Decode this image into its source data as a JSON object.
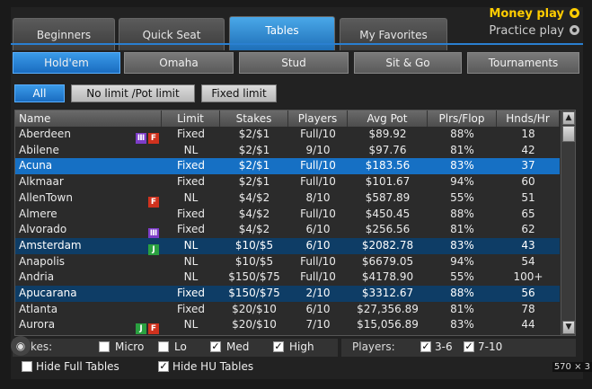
{
  "top_tabs": [
    "Beginners",
    "Quick Seat",
    "Tables",
    "My Favorites"
  ],
  "active_top_tab": "Tables",
  "mode": {
    "money": "Money play",
    "practice": "Practice play"
  },
  "game_tabs": [
    "Hold'em",
    "Omaha",
    "Stud",
    "Sit & Go",
    "Tournaments"
  ],
  "active_game_tab": "Hold'em",
  "limit_filters": [
    "All",
    "No limit /Pot limit",
    "Fixed limit"
  ],
  "active_limit_filter": "All",
  "columns": [
    "Name",
    "Limit",
    "Stakes",
    "Players",
    "Avg Pot",
    "Plrs/Flop",
    "Hnds/Hr"
  ],
  "rows": [
    {
      "name": "Aberdeen",
      "badges": [
        "stats-icon",
        "fast-icon"
      ],
      "limit": "Fixed",
      "stakes": "$2/$1",
      "players": "Full/10",
      "avg_pot": "$89.92",
      "plrs_flop": "88%",
      "hnds_hr": "18",
      "state": ""
    },
    {
      "name": "Abilene",
      "badges": [],
      "limit": "NL",
      "stakes": "$2/$1",
      "players": "9/10",
      "avg_pot": "$97.76",
      "plrs_flop": "81%",
      "hnds_hr": "42",
      "state": ""
    },
    {
      "name": "Acuna",
      "badges": [],
      "limit": "Fixed",
      "stakes": "$2/$1",
      "players": "Full/10",
      "avg_pot": "$183.56",
      "plrs_flop": "83%",
      "hnds_hr": "37",
      "state": "sel"
    },
    {
      "name": "Alkmaar",
      "badges": [],
      "limit": "Fixed",
      "stakes": "$2/$1",
      "players": "Full/10",
      "avg_pot": "$101.67",
      "plrs_flop": "94%",
      "hnds_hr": "60",
      "state": ""
    },
    {
      "name": "AllenTown",
      "badges": [
        "fast-icon"
      ],
      "limit": "NL",
      "stakes": "$4/$2",
      "players": "8/10",
      "avg_pot": "$587.89",
      "plrs_flop": "55%",
      "hnds_hr": "51",
      "state": ""
    },
    {
      "name": "Almere",
      "badges": [],
      "limit": "Fixed",
      "stakes": "$4/$2",
      "players": "Full/10",
      "avg_pot": "$450.45",
      "plrs_flop": "88%",
      "hnds_hr": "65",
      "state": ""
    },
    {
      "name": "Alvorado",
      "badges": [
        "stats-icon"
      ],
      "limit": "Fixed",
      "stakes": "$4/$2",
      "players": "6/10",
      "avg_pot": "$256.56",
      "plrs_flop": "81%",
      "hnds_hr": "62",
      "state": ""
    },
    {
      "name": "Amsterdam",
      "badges": [
        "jackpot-icon"
      ],
      "limit": "NL",
      "stakes": "$10/$5",
      "players": "6/10",
      "avg_pot": "$2082.78",
      "plrs_flop": "83%",
      "hnds_hr": "43",
      "state": "dark"
    },
    {
      "name": "Anapolis",
      "badges": [],
      "limit": "NL",
      "stakes": "$10/$5",
      "players": "Full/10",
      "avg_pot": "$6679.05",
      "plrs_flop": "94%",
      "hnds_hr": "54",
      "state": ""
    },
    {
      "name": "Andria",
      "badges": [],
      "limit": "NL",
      "stakes": "$150/$75",
      "players": "Full/10",
      "avg_pot": "$4178.90",
      "plrs_flop": "55%",
      "hnds_hr": "100+",
      "state": ""
    },
    {
      "name": "Apucarana",
      "badges": [],
      "limit": "Fixed",
      "stakes": "$150/$75",
      "players": "2/10",
      "avg_pot": "$3312.67",
      "plrs_flop": "88%",
      "hnds_hr": "56",
      "state": "dark"
    },
    {
      "name": "Atlanta",
      "badges": [],
      "limit": "Fixed",
      "stakes": "$20/$10",
      "players": "6/10",
      "avg_pot": "$27,356.89",
      "plrs_flop": "81%",
      "hnds_hr": "78",
      "state": ""
    },
    {
      "name": "Aurora",
      "badges": [
        "jackpot-icon",
        "fast-icon"
      ],
      "limit": "NL",
      "stakes": "$20/$10",
      "players": "7/10",
      "avg_pot": "$15,056.89",
      "plrs_flop": "83%",
      "hnds_hr": "44",
      "state": ""
    }
  ],
  "badge_glyphs": {
    "stats-icon": "Ⅲ",
    "fast-icon": "F",
    "jackpot-icon": "J"
  },
  "stakes_filter": {
    "label": "kes:",
    "options": [
      {
        "label": "Micro",
        "checked": false
      },
      {
        "label": "Lo",
        "checked": false
      },
      {
        "label": "Med",
        "checked": true
      },
      {
        "label": "High",
        "checked": true
      }
    ]
  },
  "players_filter": {
    "label": "Players:",
    "options": [
      {
        "label": "3-6",
        "checked": true
      },
      {
        "label": "7-10",
        "checked": true
      }
    ]
  },
  "hide_options": [
    {
      "label": "Hide Full Tables",
      "checked": false
    },
    {
      "label": "Hide HU Tables",
      "checked": true
    }
  ],
  "size_tag": "570 × 3",
  "colors": {
    "accent": "#1670c4",
    "selected_dark": "#0e3d66",
    "money": "#ffcc00"
  }
}
